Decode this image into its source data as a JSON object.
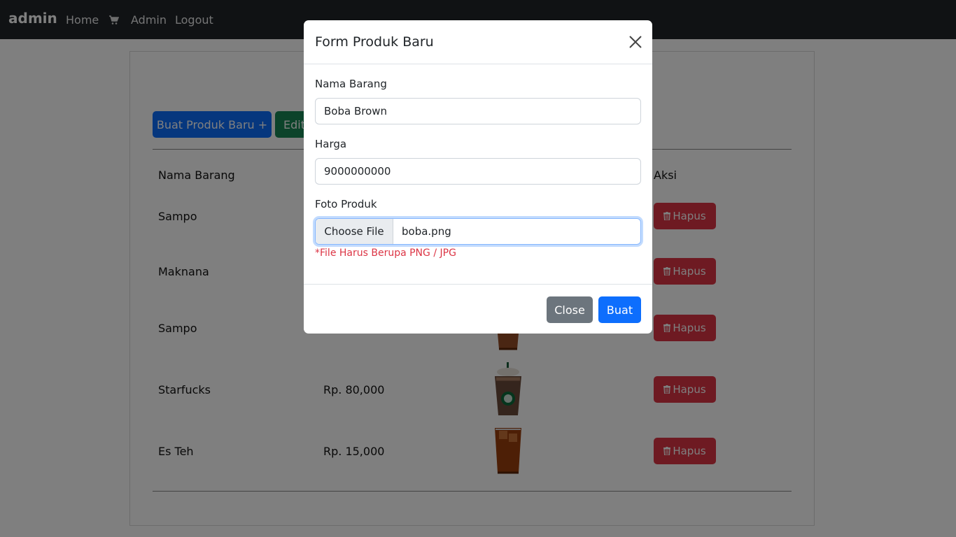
{
  "navbar": {
    "brand": "admin",
    "links": {
      "home": "Home",
      "admin": "Admin",
      "logout": "Logout"
    },
    "cart_icon": "cart-icon"
  },
  "toolbar": {
    "new_product_label": "Buat Produk Baru +",
    "edit_label": "Edit"
  },
  "table": {
    "headers": {
      "name": "Nama Barang",
      "action": "Aksi"
    },
    "delete_label": "Hapus",
    "rows": [
      {
        "name": "Sampo",
        "price": ""
      },
      {
        "name": "Maknana",
        "price": ""
      },
      {
        "name": "Sampo",
        "price": ""
      },
      {
        "name": "Starfucks",
        "price": "Rp. 80,000"
      },
      {
        "name": "Es Teh",
        "price": "Rp. 15,000"
      }
    ]
  },
  "modal": {
    "title": "Form Produk Baru",
    "name_label": "Nama Barang",
    "name_value": "Boba Brown",
    "price_label": "Harga",
    "price_value": "9000000000",
    "photo_label": "Foto Produk",
    "file_button": "Choose File",
    "file_name": "boba.png",
    "help_text": "*File Harus Berupa PNG / JPG",
    "close_label": "Close",
    "submit_label": "Buat"
  },
  "colors": {
    "primary": "#0d6efd",
    "success": "#198754",
    "danger": "#dc3545",
    "secondary": "#6c757d",
    "navbar": "#212529"
  }
}
